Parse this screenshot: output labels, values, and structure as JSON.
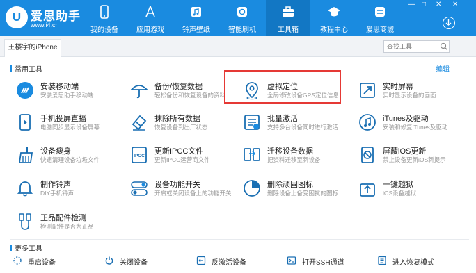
{
  "window_controls": {
    "minimize": "—",
    "maximize": "□",
    "close": "✕"
  },
  "brand": {
    "name": "爱思助手",
    "url": "www.i4.cn",
    "logo_letter": "U",
    "color": "#1a8be0"
  },
  "nav": [
    {
      "label": "我的设备",
      "icon": "phone-icon"
    },
    {
      "label": "应用游戏",
      "icon": "app-store-icon"
    },
    {
      "label": "铃声壁纸",
      "icon": "music-icon"
    },
    {
      "label": "智能刷机",
      "icon": "flash-icon"
    },
    {
      "label": "工具箱",
      "icon": "toolbox-icon",
      "active": true
    },
    {
      "label": "教程中心",
      "icon": "graduation-cap-icon"
    },
    {
      "label": "爱思商城",
      "icon": "store-icon"
    }
  ],
  "device_tab": {
    "label": "王楼宇的iPhone"
  },
  "search": {
    "placeholder": "查找工具"
  },
  "sections": {
    "common": {
      "title": "常用工具",
      "edit": "编辑"
    },
    "more": {
      "title": "更多工具"
    }
  },
  "tools": [
    {
      "title": "安装移动端",
      "desc": "安装爱思助手移动端",
      "icon": "install-mobile-icon"
    },
    {
      "title": "备份/恢复数据",
      "desc": "轻松备份和恢复设备的资料",
      "icon": "umbrella-backup-icon"
    },
    {
      "title": "虚拟定位",
      "desc": "全局修改设备GPS定位信息",
      "icon": "location-pin-icon",
      "highlighted": true
    },
    {
      "title": "实时屏幕",
      "desc": "实时显示设备的画面",
      "icon": "live-screen-icon"
    },
    {
      "title": "手机投屏直播",
      "desc": "电脑同步显示设备屏幕",
      "icon": "screen-mirror-icon"
    },
    {
      "title": "抹除所有数据",
      "desc": "恢复设备到出厂状态",
      "icon": "eraser-icon"
    },
    {
      "title": "批量激活",
      "desc": "支持多台设备同时进行激活",
      "icon": "batch-activate-icon"
    },
    {
      "title": "iTunes及驱动",
      "desc": "安装和修复iTunes及驱动",
      "icon": "itunes-icon"
    },
    {
      "title": "设备瘦身",
      "desc": "快速清理设备垃圾文件",
      "icon": "broom-icon"
    },
    {
      "title": "更新IPCC文件",
      "desc": "更新IPCC运营商文件",
      "icon": "ipcc-icon"
    },
    {
      "title": "迁移设备数据",
      "desc": "把资料迁移至新设备",
      "icon": "migrate-icon"
    },
    {
      "title": "屏蔽iOS更新",
      "desc": "禁止设备更新iOS新提示",
      "icon": "block-update-icon"
    },
    {
      "title": "制作铃声",
      "desc": "DIY手机铃声",
      "icon": "ringtone-bell-icon"
    },
    {
      "title": "设备功能开关",
      "desc": "开启或关闭设备上的功能开关",
      "icon": "toggle-switch-icon"
    },
    {
      "title": "删除顽固图标",
      "desc": "删除设备上备受困扰的图标",
      "icon": "delete-icon-icon"
    },
    {
      "title": "一键越狱",
      "desc": "iOS设备越狱",
      "icon": "jailbreak-icon"
    },
    {
      "title": "正品配件检测",
      "desc": "检测配件是否为正品",
      "icon": "cable-check-icon"
    }
  ],
  "more_tools": [
    {
      "label": "重启设备",
      "icon": "restart-icon"
    },
    {
      "label": "关闭设备",
      "icon": "power-icon"
    },
    {
      "label": "反激活设备",
      "icon": "deactivate-icon"
    },
    {
      "label": "打开SSH通道",
      "icon": "ssh-terminal-icon"
    },
    {
      "label": "进入恢复模式",
      "icon": "recovery-mode-icon"
    }
  ]
}
